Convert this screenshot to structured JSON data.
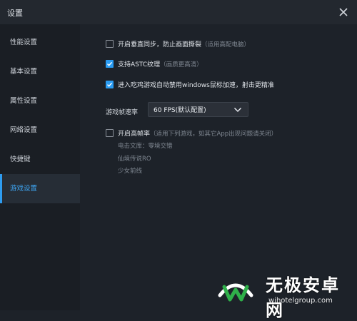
{
  "window": {
    "title": "设置"
  },
  "sidebar": {
    "items": [
      {
        "label": "性能设置"
      },
      {
        "label": "基本设置"
      },
      {
        "label": "属性设置"
      },
      {
        "label": "网络设置"
      },
      {
        "label": "快捷键"
      },
      {
        "label": "游戏设置",
        "active": true
      }
    ]
  },
  "options": {
    "vsync": {
      "label": "开启垂直同步，防止画面撕裂",
      "note": "（适用高配电脑）",
      "checked": false
    },
    "astc": {
      "label": "支持ASTC纹理",
      "note": "（画质更高清）",
      "checked": true
    },
    "mouse_accel": {
      "label": "进入吃鸡游戏自动禁用windows鼠标加速，射击更精准",
      "checked": true
    },
    "high_fps": {
      "label": "开启高帧率",
      "note": "（适用下列游戏，如其它App出现问题请关闭）",
      "checked": false
    }
  },
  "fps": {
    "label": "游戏帧速率",
    "selected": "60 FPS(默认配置)"
  },
  "games": [
    "电击文库：零境交错",
    "仙境传说RO",
    "少女前线"
  ],
  "watermark": {
    "name": "无极安卓网",
    "url": "wjhotelgroup.com"
  },
  "colors": {
    "accent": "#2a9cf2",
    "background": "#1d2229",
    "sidebar": "#1a1e24"
  }
}
